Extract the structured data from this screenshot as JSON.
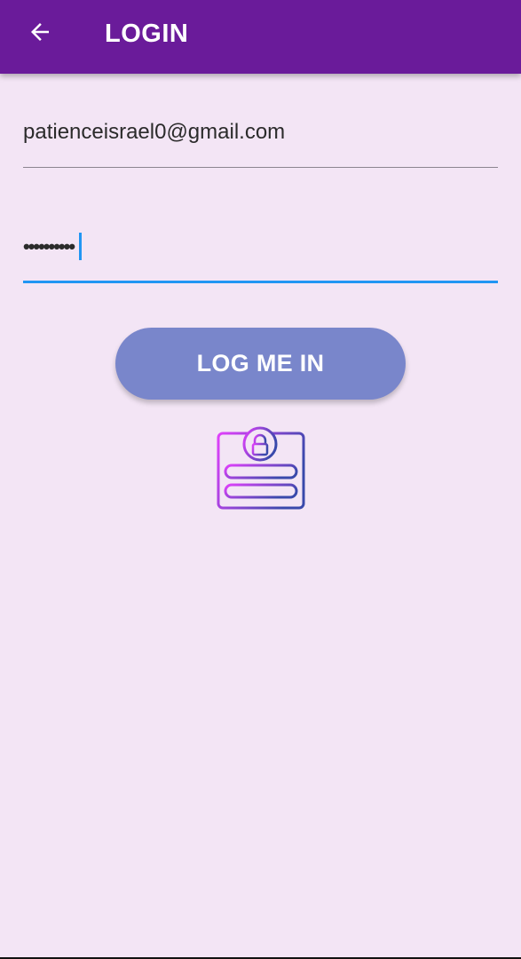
{
  "app": {
    "title": "LOGIN",
    "bar_color": "#6a1b9a",
    "background_color": "#f3e5f5"
  },
  "appbar": {
    "back_icon": "arrow-left-icon"
  },
  "form": {
    "email": {
      "value": "patienceisrael0@gmail.com"
    },
    "password": {
      "masked_value": "••••••••••",
      "focused": true,
      "focus_color": "#2196f3"
    },
    "submit_label": "LOG ME IN",
    "button_color": "#7986cb"
  },
  "illustration": {
    "icon": "login-form-lock-icon",
    "gradient_colors": [
      "#e040fb",
      "#3949ab"
    ]
  }
}
